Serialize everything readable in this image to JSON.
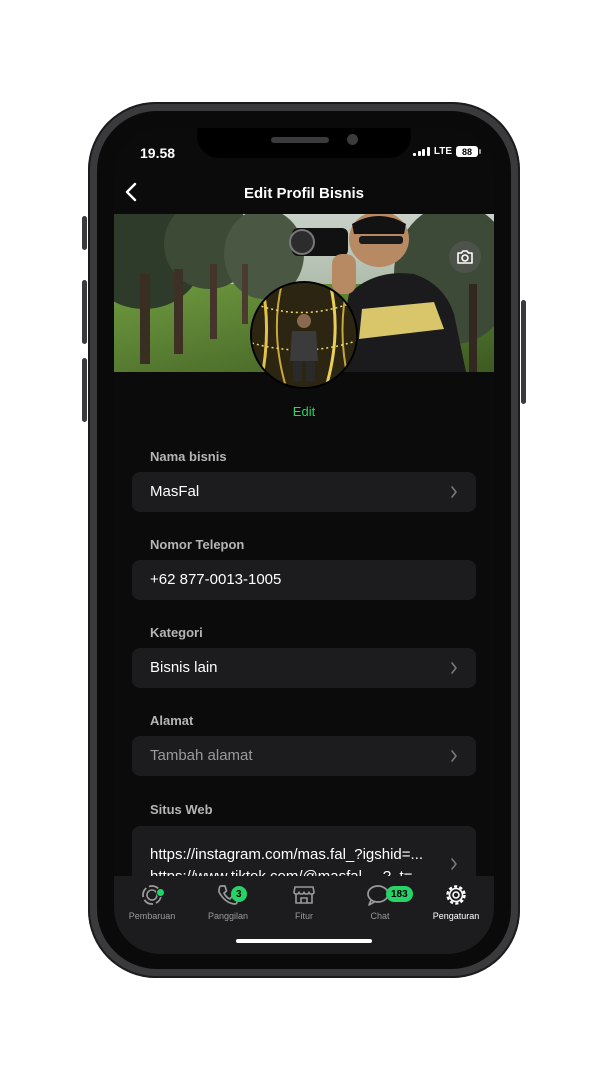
{
  "status": {
    "time": "19.58",
    "network": "LTE",
    "battery": "88"
  },
  "header": {
    "title": "Edit Profil Bisnis",
    "back_icon": "chevron-left-icon"
  },
  "profile": {
    "edit_label": "Edit",
    "cover_camera_icon": "camera-icon"
  },
  "fields": [
    {
      "label": "Nama bisnis",
      "value": "MasFal",
      "has_chevron": true
    },
    {
      "label": "Nomor Telepon",
      "value": "+62 877-0013-1005",
      "has_chevron": false
    },
    {
      "label": "Kategori",
      "value": "Bisnis lain",
      "has_chevron": true
    },
    {
      "label": "Alamat",
      "placeholder": "Tambah alamat",
      "has_chevron": true
    },
    {
      "label": "Situs Web",
      "value": "https://instagram.com/mas.fal_?igshid=...",
      "value_line2": "https://www.tiktok.com/@masfal_...?_t=...",
      "has_chevron": true
    }
  ],
  "tabs": [
    {
      "label": "Pembaruan",
      "icon": "updates-icon",
      "badge_dot": true
    },
    {
      "label": "Panggilan",
      "icon": "phone-icon",
      "badge": "3"
    },
    {
      "label": "Fitur",
      "icon": "store-icon"
    },
    {
      "label": "Chat",
      "icon": "chat-bubbles-icon",
      "badge": "183"
    },
    {
      "label": "Pengaturan",
      "icon": "gear-icon",
      "active": true
    }
  ],
  "colors": {
    "accent": "#25d366",
    "background": "#0b0b0b",
    "field": "#1c1c1e"
  }
}
